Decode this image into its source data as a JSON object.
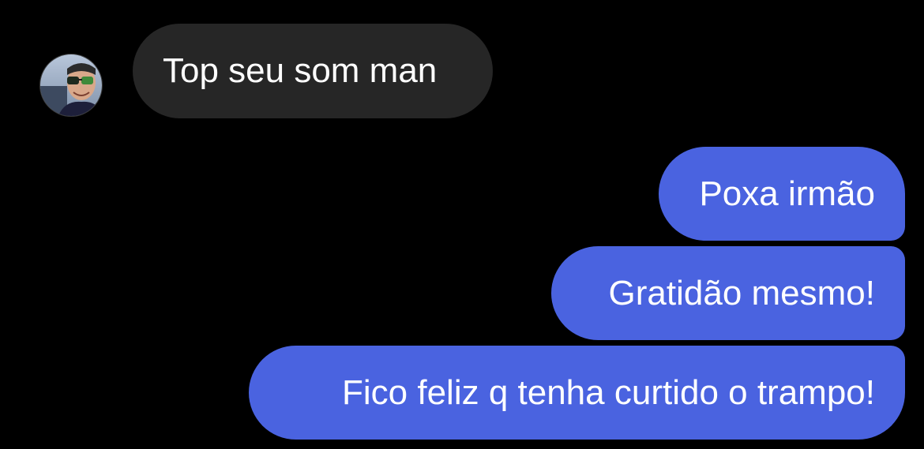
{
  "contact": {
    "avatar_icon": "profile-photo-avatar"
  },
  "messages": {
    "incoming": [
      {
        "text": "Top seu som man"
      }
    ],
    "outgoing": [
      {
        "text": "Poxa irmão"
      },
      {
        "text": "Gratidão mesmo!"
      },
      {
        "text": "Fico feliz q tenha curtido o trampo!"
      }
    ]
  },
  "colors": {
    "background": "#000000",
    "incoming_bubble": "#262626",
    "outgoing_bubble": "#4a63e0",
    "text": "#ffffff"
  }
}
